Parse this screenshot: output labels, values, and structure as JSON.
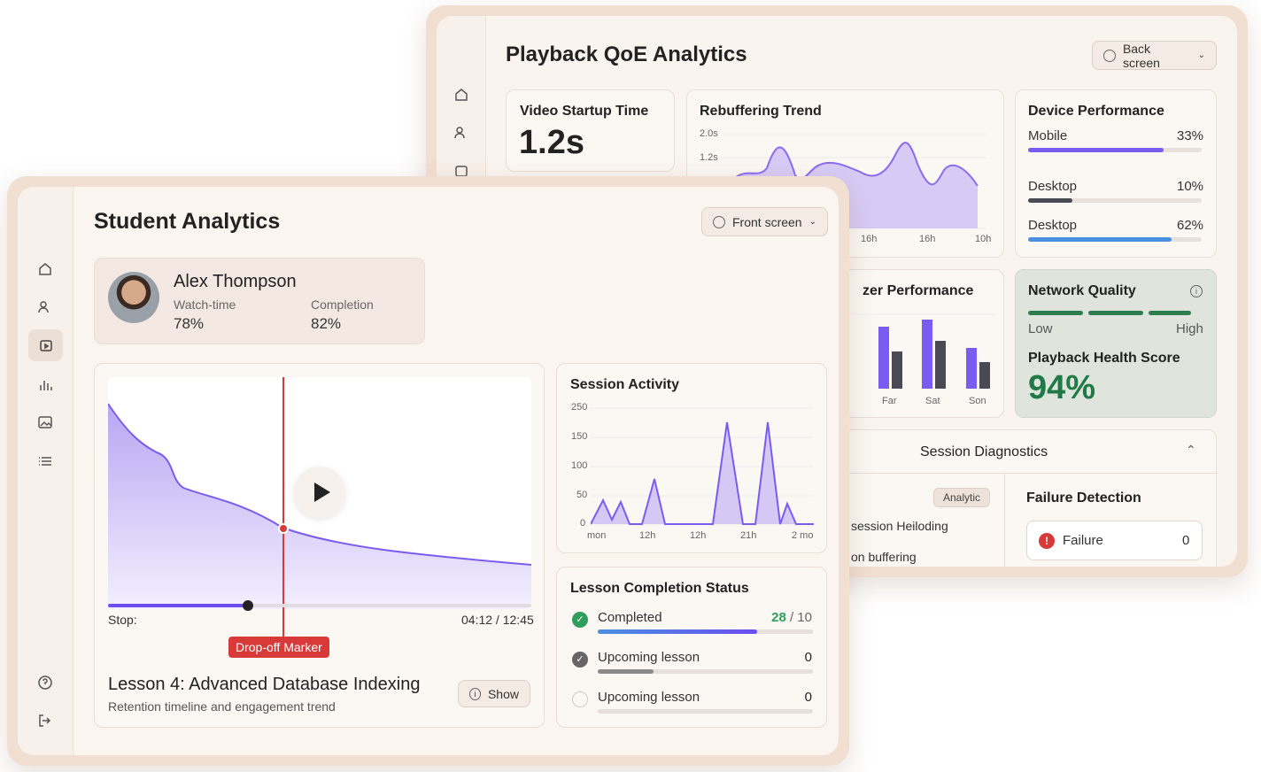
{
  "back": {
    "title": "Playback QoE Analytics",
    "back_button": "Back screen",
    "startup": {
      "title": "Video Startup Time",
      "value": "1.2s"
    },
    "rebuffer": {
      "title": "Rebuffering Trend",
      "yticks": [
        "2.0s",
        "1.2s"
      ],
      "xticks": [
        "16h",
        "16h",
        "10h"
      ]
    },
    "device": {
      "title": "Device Performance",
      "rows": [
        {
          "name": "Mobile",
          "pct": "33%",
          "level": 0.85,
          "color": "#7b5cf0"
        },
        {
          "name": "Desktop",
          "pct": "10%",
          "level": 0.28,
          "color": "#4a4a55"
        },
        {
          "name": "Desktop",
          "pct": "62%",
          "level": 0.9,
          "color": "#4a90e2"
        }
      ]
    },
    "server": {
      "title": "zer Performance",
      "xticks": [
        "Far",
        "Sat",
        "Son"
      ]
    },
    "network": {
      "title": "Network Quality",
      "low": "Low",
      "high": "High",
      "score_title": "Playback Health Score",
      "score": "94%"
    },
    "diagnostics": {
      "title": "Session Diagnostics",
      "badge": "Analytic",
      "line1": "session Heiloding",
      "line2": "on buffering",
      "failure_title": "Failure Detection",
      "failure_label": "Failure",
      "failure_count": "0"
    }
  },
  "front": {
    "title": "Student Analytics",
    "front_button": "Front screen",
    "student": {
      "name": "Alex Thompson",
      "watch_label": "Watch-time",
      "watch_value": "78%",
      "comp_label": "Completion",
      "comp_value": "82%"
    },
    "video": {
      "stop_label": "Stop:",
      "time": "04:12 / 12:45",
      "marker": "Drop-off Marker",
      "progress": 0.33,
      "lesson_title": "Lesson 4: Advanced Database Indexing",
      "lesson_sub": "Retention timeline and engagement trend",
      "show_button": "Show"
    },
    "session": {
      "title": "Session Activity",
      "yticks": [
        "250",
        "150",
        "100",
        "50",
        "0"
      ],
      "xticks": [
        "mon",
        "12h",
        "12h",
        "21h",
        "2 mo"
      ]
    },
    "lessons": {
      "title": "Lesson Completion Status",
      "rows": [
        {
          "label": "Completed",
          "count": "28",
          "total": "/ 10",
          "level": 0.74
        },
        {
          "label": "Upcoming lesson",
          "count": "0",
          "total": "",
          "level": 0.26
        },
        {
          "label": "Upcoming lesson",
          "count": "0",
          "total": "",
          "level": 0
        }
      ]
    }
  }
}
